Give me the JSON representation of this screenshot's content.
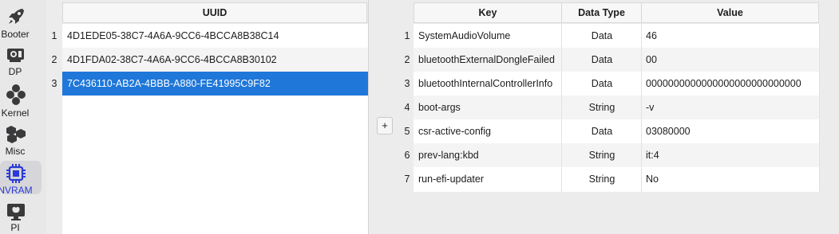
{
  "sidebar": {
    "items": [
      {
        "label": "Booter",
        "icon": "rocket-icon"
      },
      {
        "label": "DP",
        "icon": "graphics-card-icon"
      },
      {
        "label": "Kernel",
        "icon": "kernel-icon"
      },
      {
        "label": "Misc",
        "icon": "misc-icon"
      },
      {
        "label": "NVRAM",
        "icon": "chip-icon",
        "active": true
      },
      {
        "label": "PI",
        "icon": "apple-icon"
      }
    ]
  },
  "uuid_table": {
    "header": "UUID",
    "rows": [
      {
        "num": "1",
        "uuid": "4D1EDE05-38C7-4A6A-9CC6-4BCCA8B38C14"
      },
      {
        "num": "2",
        "uuid": "4D1FDA02-38C7-4A6A-9CC6-4BCCA8B30102"
      },
      {
        "num": "3",
        "uuid": "7C436110-AB2A-4BBB-A880-FE41995C9F82",
        "selected": true
      }
    ]
  },
  "add_button": "+",
  "vars_table": {
    "headers": {
      "key": "Key",
      "type": "Data Type",
      "value": "Value"
    },
    "rows": [
      {
        "num": "1",
        "key": "SystemAudioVolume",
        "type": "Data",
        "value": "46"
      },
      {
        "num": "2",
        "key": "bluetoothExternalDongleFailed",
        "type": "Data",
        "value": "00"
      },
      {
        "num": "3",
        "key": "bluetoothInternalControllerInfo",
        "type": "Data",
        "value": "0000000000000000000000000000"
      },
      {
        "num": "4",
        "key": "boot-args",
        "type": "String",
        "value": "-v"
      },
      {
        "num": "5",
        "key": "csr-active-config",
        "type": "Data",
        "value": "03080000"
      },
      {
        "num": "6",
        "key": "prev-lang:kbd",
        "type": "String",
        "value": "it:4"
      },
      {
        "num": "7",
        "key": "run-efi-updater",
        "type": "String",
        "value": "No"
      }
    ]
  },
  "colors": {
    "selection": "#1f77d9",
    "active_label": "#2a3bd6",
    "icon": "#3a3a3c"
  }
}
